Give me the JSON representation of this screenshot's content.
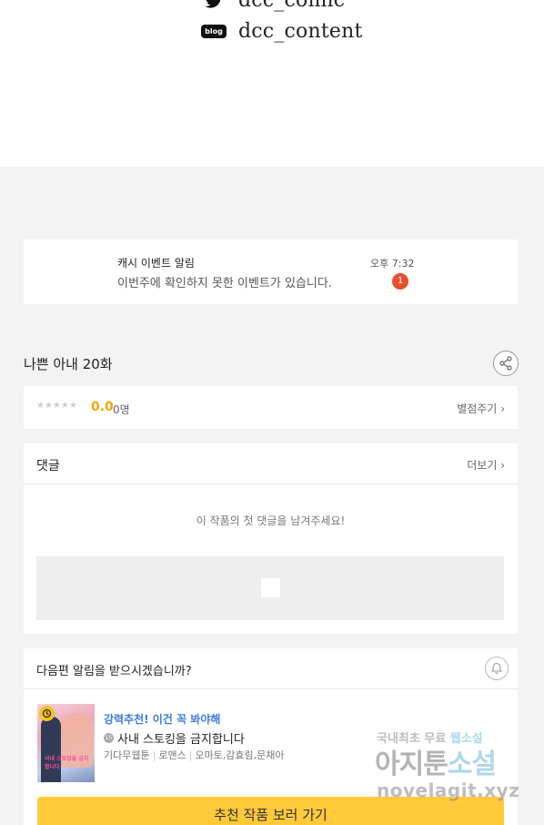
{
  "social": {
    "twitter_handle": "dcc_comic",
    "blog_label": "blog",
    "blog_handle": "dcc_content"
  },
  "notification": {
    "title": "캐시 이벤트 알림",
    "message": "이번주에 확인하지 못한 이벤트가 있습니다.",
    "time": "오후 7:32",
    "badge_count": "1"
  },
  "episode": {
    "title": "나쁜 아내 20화"
  },
  "rating": {
    "stars": "★★★★★",
    "score": "0.0",
    "count": "0명",
    "rate_link": "별점주기"
  },
  "comments": {
    "label": "댓글",
    "more": "더보기",
    "empty_text": "이 작품의 첫 댓글을 남겨주세요!"
  },
  "next_alert": {
    "question": "다음편 알림을 받으시겠습니까?"
  },
  "recommendation": {
    "tag": "강력추천! 이건 꼭 봐야해",
    "age_rating": "15",
    "title": "사내 스토킹을 금지합니다",
    "meta": [
      "기다무웹툰",
      "로맨스",
      "오마토,감효림,문채아"
    ],
    "cover_text": "사내 스토킹을 금지합니다",
    "cta": "추천 작품 보러 가기"
  },
  "watermark": {
    "line1_a": "국내최초 무료",
    "line1_b": "웹소설",
    "line2_a": "아지툰",
    "line2_b": "소설",
    "line3": "novelagit.xyz"
  },
  "colors": {
    "accent_yellow": "#ffc93a",
    "score_orange": "#f4a700",
    "badge_red": "#e8512b",
    "link_blue": "#3a7ce0"
  }
}
